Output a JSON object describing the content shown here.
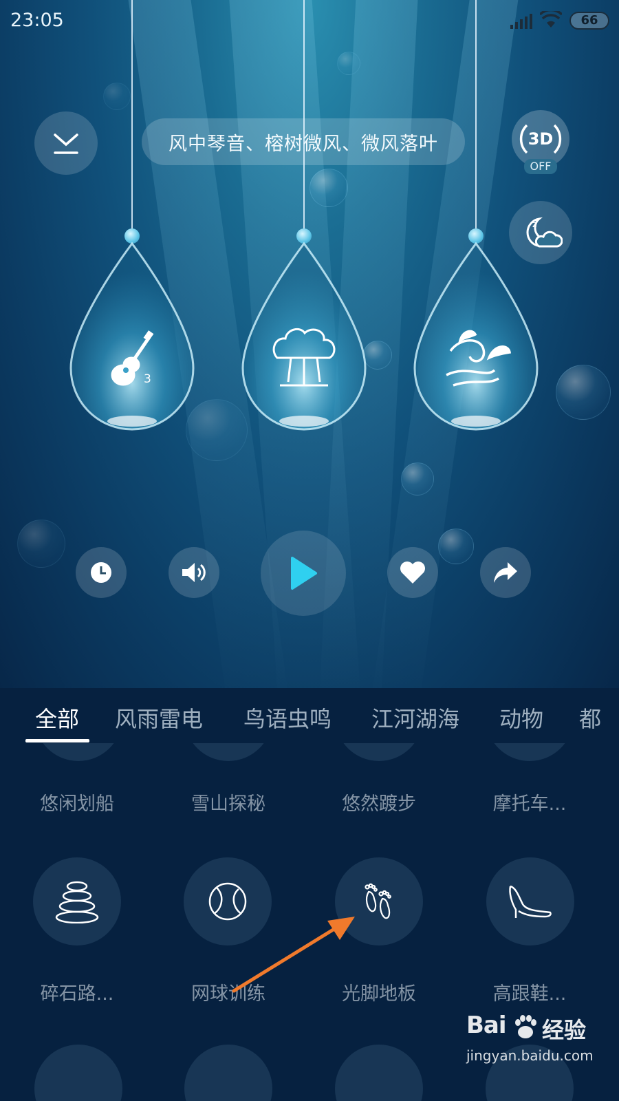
{
  "status_bar": {
    "time": "23:05",
    "battery": "66"
  },
  "header": {
    "sound_title": "风中琴音、榕树微风、微风落叶",
    "three_d_label": "3D",
    "three_d_state": "OFF"
  },
  "drops": [
    {
      "name": "guitar",
      "icon": "guitar-icon",
      "badge": "3"
    },
    {
      "name": "banyan-tree",
      "icon": "banyan-tree-icon"
    },
    {
      "name": "breeze-leaf",
      "icon": "wind-leaf-icon"
    }
  ],
  "controls": {
    "timer": "clock-icon",
    "volume": "speaker-icon",
    "play": "play-icon",
    "favorite": "heart-icon",
    "share": "share-icon"
  },
  "tabs": [
    {
      "label": "全部",
      "active": true
    },
    {
      "label": "风雨雷电"
    },
    {
      "label": "鸟语虫鸣"
    },
    {
      "label": "江河湖海"
    },
    {
      "label": "动物"
    },
    {
      "label": "都"
    }
  ],
  "grid": {
    "row1_labels": [
      "悠闲划船",
      "雪山探秘",
      "悠然踱步",
      "摩托车..."
    ],
    "row2": [
      {
        "label": "碎石路...",
        "icon": "stacked-stones-icon"
      },
      {
        "label": "网球训练",
        "icon": "tennis-ball-icon"
      },
      {
        "label": "光脚地板",
        "icon": "bare-feet-icon"
      },
      {
        "label": "高跟鞋...",
        "icon": "high-heel-icon"
      }
    ]
  },
  "watermark": {
    "brand": "Bai",
    "brand2": "经验",
    "url": "jingyan.baidu.com"
  },
  "colors": {
    "play_accent": "#2fd0f0",
    "annotation_arrow": "#f07a2c",
    "background": "#062140"
  }
}
